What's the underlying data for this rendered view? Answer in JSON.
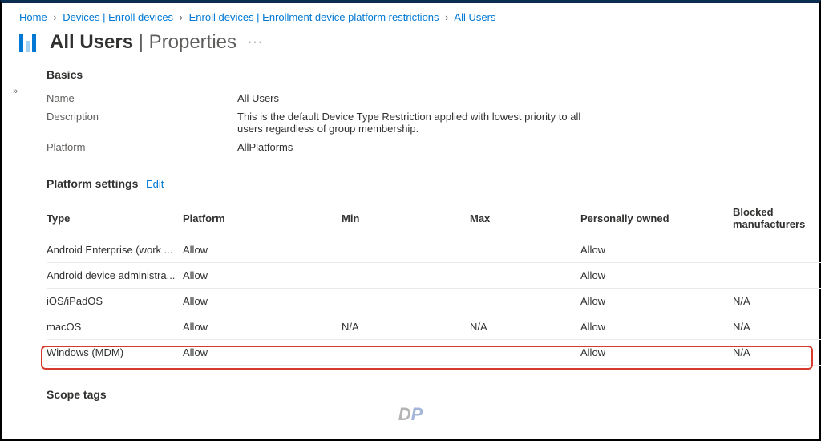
{
  "breadcrumb": [
    "Home",
    "Devices | Enroll devices",
    "Enroll devices | Enrollment device platform restrictions",
    "All Users"
  ],
  "header": {
    "title": "All Users",
    "subtitle": "Properties",
    "more": "···"
  },
  "expander": "»",
  "basics": {
    "heading": "Basics",
    "name_label": "Name",
    "name_value": "All Users",
    "desc_label": "Description",
    "desc_value": "This is the default Device Type Restriction applied with lowest priority to all users regardless of group membership.",
    "platform_label": "Platform",
    "platform_value": "AllPlatforms"
  },
  "platform_settings": {
    "heading": "Platform settings",
    "edit": "Edit",
    "columns": {
      "type": "Type",
      "platform": "Platform",
      "min": "Min",
      "max": "Max",
      "po": "Personally owned",
      "bm": "Blocked manufacturers"
    },
    "rows": [
      {
        "type": "Android Enterprise (work ...",
        "platform": "Allow",
        "min": "",
        "max": "",
        "po": "Allow",
        "bm": ""
      },
      {
        "type": "Android device administra...",
        "platform": "Allow",
        "min": "",
        "max": "",
        "po": "Allow",
        "bm": ""
      },
      {
        "type": "iOS/iPadOS",
        "platform": "Allow",
        "min": "",
        "max": "",
        "po": "Allow",
        "bm": "N/A"
      },
      {
        "type": "macOS",
        "platform": "Allow",
        "min": "N/A",
        "max": "N/A",
        "po": "Allow",
        "bm": "N/A",
        "highlighted": true
      },
      {
        "type": "Windows (MDM)",
        "platform": "Allow",
        "min": "",
        "max": "",
        "po": "Allow",
        "bm": "N/A"
      }
    ]
  },
  "scope": {
    "heading": "Scope tags"
  },
  "watermark": {
    "p1": "D",
    "p2": "P"
  }
}
